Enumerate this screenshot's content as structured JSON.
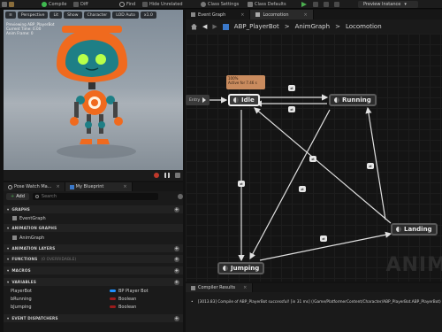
{
  "toolbar": {
    "compile_label": "Compile",
    "diff_label": "Diff",
    "find_label": "Find",
    "hide_unrelated_label": "Hide Unrelated",
    "class_settings_label": "Class Settings",
    "class_defaults_label": "Class Defaults",
    "preview_instance_label": "Preview Instance"
  },
  "viewport": {
    "perspective_label": "Perspective",
    "lit_label": "Lit",
    "show_label": "Show",
    "character_label": "Character",
    "lod_label": "LOD Auto",
    "speed_label": "x1.0",
    "overlay_lines": [
      "Previewing ABP_PlayerBot",
      "Current Time: 0.00",
      "Anim Frame: 0"
    ]
  },
  "left_tabs": {
    "pose_watch": "Pose Watch Ma...",
    "my_blueprint": "My Blueprint"
  },
  "my_blueprint": {
    "add_label": "Add",
    "search_placeholder": "Search",
    "sections": {
      "graphs": "GRAPHS",
      "animation_graphs": "ANIMATION GRAPHS",
      "animation_layers": "ANIMATION LAYERS",
      "functions": "FUNCTIONS",
      "functions_sub": "(0 OVERRIDABLE)",
      "macros": "MACROS",
      "variables": "VARIABLES",
      "event_dispatchers": "EVENT DISPATCHERS"
    },
    "event_graph": "EventGraph",
    "anim_graph": "AnimGraph",
    "variables": [
      {
        "name": "PlayerBot",
        "type": "BP Player Bot"
      },
      {
        "name": "bRunning",
        "type": "Boolean"
      },
      {
        "name": "bJumping",
        "type": "Boolean"
      }
    ]
  },
  "graph_tabs": {
    "event_graph": "Event Graph",
    "locomotion": "Locomotion"
  },
  "breadcrumb": {
    "blueprint": "ABP_PlayerBot",
    "sep": ">",
    "anim_graph": "AnimGraph",
    "locomotion": "Locomotion"
  },
  "state_machine": {
    "entry_label": "Entry",
    "tooltip_lines": [
      "100%",
      "Active for 7.46 s"
    ],
    "states": {
      "idle": "Idle",
      "running": "Running",
      "landing": "Landing",
      "jumping": "Jumping"
    },
    "watermark": "ANIM"
  },
  "compiler": {
    "tab_label": "Compiler Results",
    "message": "[3013.83] Compile of ABP_PlayerBot successful! [in 31 ms] (/Game/PlatformerContent/Character/ABP_PlayerBot.ABP_PlayerBot)"
  },
  "colors": {
    "compile_ok": "#3fb950",
    "play_green": "#4caf50",
    "tooltip_orange": "#c98b5e",
    "bool_red": "#9b1b1b",
    "object_blue": "#1e90ff",
    "robot_orange": "#f06a1e",
    "robot_teal": "#1e7f86"
  },
  "icons": [
    "compile-icon",
    "diff-icon",
    "find-icon",
    "hide-unrelated-icon",
    "class-settings-icon",
    "class-defaults-icon",
    "play-icon",
    "search-icon",
    "add-icon",
    "graph-icon",
    "state-icon",
    "transition-icon",
    "home-icon",
    "back-icon",
    "forward-icon",
    "record-icon",
    "pause-icon"
  ]
}
